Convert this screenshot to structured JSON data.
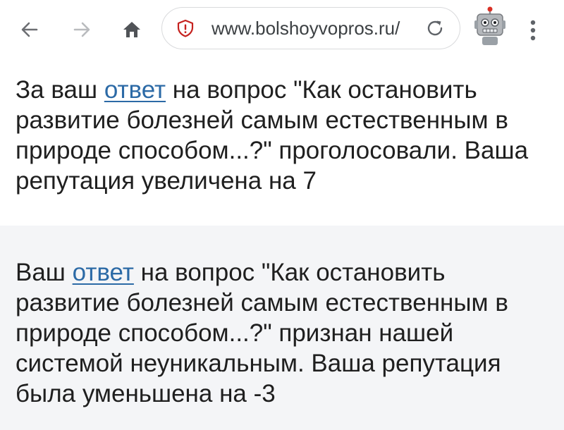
{
  "browser": {
    "url": "www.bolshoyvopros.ru/",
    "icons": {
      "back": "arrow-left-icon",
      "forward": "arrow-right-icon",
      "home": "home-icon",
      "security": "shield-icon",
      "reload": "reload-icon",
      "extension": "robot-icon",
      "menu": "more-vertical-icon"
    }
  },
  "notifications": [
    {
      "prefix": "За ваш ",
      "link": "ответ",
      "suffix": " на вопрос \"Как остановить развитие болезней самым естественным в природе способом...?\" проголосовали. Ваша репутация увеличена на 7"
    },
    {
      "prefix": "Ваш ",
      "link": "ответ",
      "suffix": " на вопрос \"Как остановить развитие болезней самым естественным в природе способом...?\" признан нашей системой неуникальным. Ваша репутация была уменьшена на -3"
    }
  ],
  "colors": {
    "link": "#2c6aa6",
    "security_icon": "#c5221f",
    "second_notice_bg": "#f4f5f7"
  }
}
